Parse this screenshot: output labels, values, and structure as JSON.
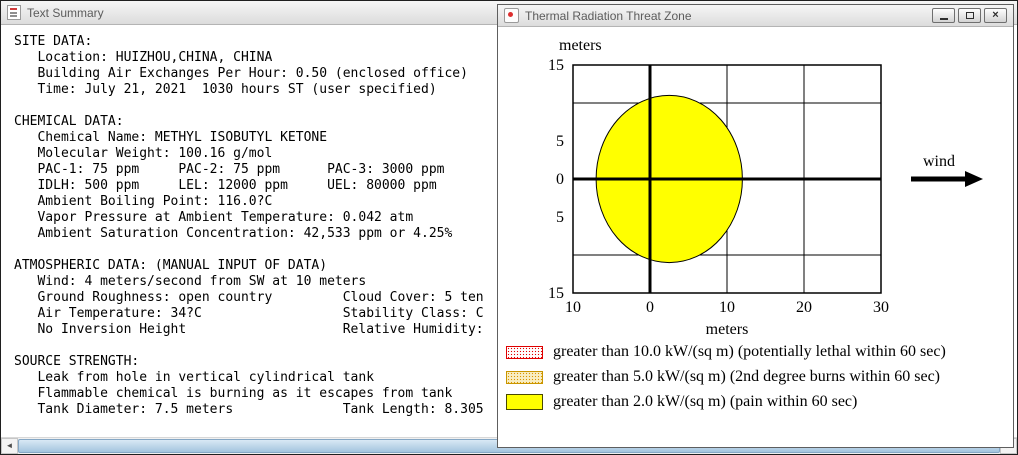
{
  "text_summary_window": {
    "title": "Text Summary",
    "body_text": "SITE DATA:\n   Location: HUIZHOU,CHINA, CHINA\n   Building Air Exchanges Per Hour: 0.50 (enclosed office)\n   Time: July 21, 2021  1030 hours ST (user specified)\n\nCHEMICAL DATA:\n   Chemical Name: METHYL ISOBUTYL KETONE\n   Molecular Weight: 100.16 g/mol\n   PAC-1: 75 ppm     PAC-2: 75 ppm      PAC-3: 3000 ppm\n   IDLH: 500 ppm     LEL: 12000 ppm     UEL: 80000 ppm\n   Ambient Boiling Point: 116.0?C\n   Vapor Pressure at Ambient Temperature: 0.042 atm\n   Ambient Saturation Concentration: 42,533 ppm or 4.25%\n\nATMOSPHERIC DATA: (MANUAL INPUT OF DATA)\n   Wind: 4 meters/second from SW at 10 meters\n   Ground Roughness: open country         Cloud Cover: 5 ten\n   Air Temperature: 34?C                  Stability Class: C\n   No Inversion Height                    Relative Humidity:\n\nSOURCE STRENGTH:\n   Leak from hole in vertical cylindrical tank\n   Flammable chemical is burning as it escapes from tank\n   Tank Diameter: 7.5 meters              Tank Length: 8.305",
    "scrollbar": {
      "left_arrow": "◄",
      "right_arrow": "►"
    }
  },
  "thermal_window": {
    "title": "Thermal Radiation Threat Zone",
    "close_icon_glyph": "×",
    "wind_label": "wind",
    "chart_data": {
      "type": "area",
      "title": "Thermal Radiation Threat Zone",
      "xlabel": "meters",
      "ylabel": "meters",
      "xlim": [
        -10,
        30
      ],
      "ylim": [
        -15,
        15
      ],
      "x_tick_values": [
        -10,
        0,
        10,
        20,
        30
      ],
      "x_tick_labels": [
        "10",
        "0",
        "10",
        "20",
        "30"
      ],
      "y_tick_values": [
        15,
        5,
        0,
        -5,
        -15
      ],
      "y_tick_labels": [
        "15",
        "5",
        "0",
        "5",
        "15"
      ],
      "x_gridline_values": [
        10,
        20
      ],
      "y_gridline_values": [
        10,
        -10
      ],
      "axis_line_values": {
        "x": 0,
        "y": 0
      },
      "grid": true,
      "wind": {
        "label": "wind",
        "direction": "downwind-right"
      },
      "zones": [
        {
          "threat": "greater than 2.0 kW/(sq m)",
          "shape": "ellipse",
          "center_m": [
            2.5,
            0
          ],
          "rx_m": 9.5,
          "ry_m": 11,
          "fill": "#ffff00",
          "outline": "#000000"
        }
      ]
    },
    "legend": [
      {
        "swatch": "red-stipple",
        "color": "#ff0000",
        "label": "greater than 10.0 kW/(sq m) (potentially lethal within 60 sec)"
      },
      {
        "swatch": "orange-stipple",
        "color": "#dd9400",
        "label": "greater than 5.0 kW/(sq m) (2nd degree burns within 60 sec)"
      },
      {
        "swatch": "solid-yellow",
        "color": "#ffff00",
        "label": "greater than 2.0 kW/(sq m) (pain within 60 sec)"
      }
    ]
  }
}
